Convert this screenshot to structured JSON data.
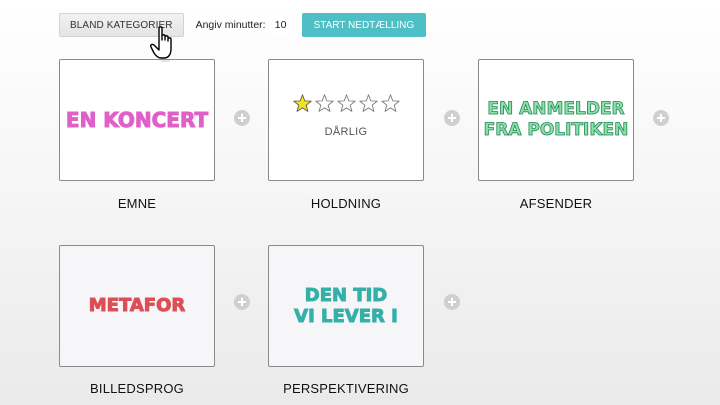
{
  "toolbar": {
    "shuffle_label": "BLAND KATEGORIER",
    "minutes_label": "Angiv minutter:",
    "minutes_value": "10",
    "start_label": "START NEDTÆLLING"
  },
  "cards": {
    "emne": {
      "value": "EN KONCERT",
      "label": "EMNE"
    },
    "holdning": {
      "rating": 1,
      "max_rating": 5,
      "rating_text": "DÅRLIG",
      "label": "HOLDNING"
    },
    "afsender": {
      "value_line1": "EN ANMELDER",
      "value_line2": "FRA POLITIKEN",
      "label": "AFSENDER"
    },
    "billedsprog": {
      "value": "METAFOR",
      "label": "BILLEDSPROG"
    },
    "perspektivering": {
      "value_line1": "DEN TID",
      "value_line2": "VI LEVER I",
      "label": "PERSPEKTIVERING"
    }
  },
  "colors": {
    "accent": "#4ebfc4",
    "emne_text": "#e160c8",
    "afsender_text": "#8fe0a8",
    "billedsprog_text": "#dc4f57",
    "perspektivering_text": "#35b0a8",
    "star_filled": "#f4e21c"
  },
  "icons": {
    "cursor": "hand-pointer-icon",
    "add": "plus-circle-icon",
    "star": "star-icon"
  }
}
